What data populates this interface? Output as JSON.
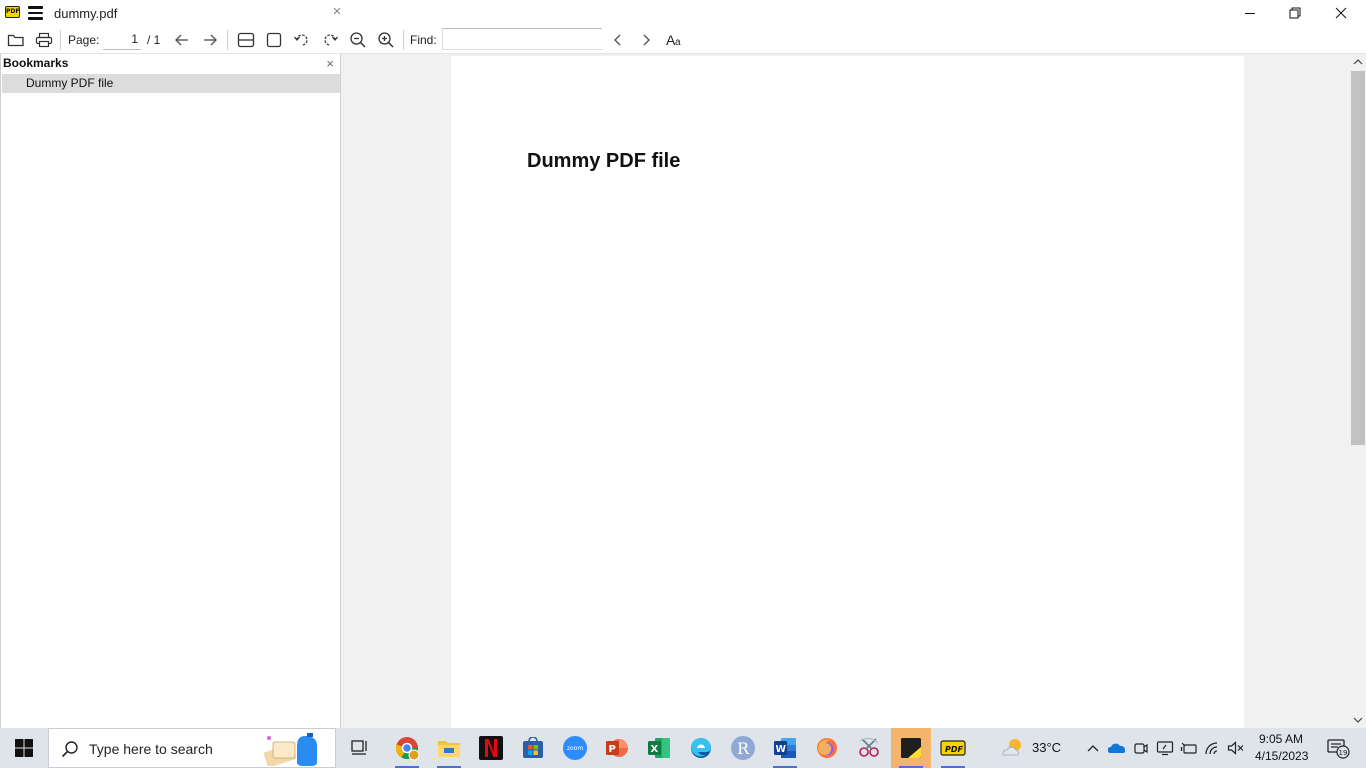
{
  "window": {
    "tab_title": "dummy.pdf",
    "tab_close": "×",
    "app_logo": "PDF"
  },
  "toolbar": {
    "page_label": "Page:",
    "page_value": "1",
    "page_total": "/ 1",
    "find_label": "Find:",
    "find_value": "",
    "icons": [
      "open-folder-icon",
      "print-icon",
      "prev-page-icon",
      "next-page-icon",
      "fit-width-icon",
      "fit-page-icon",
      "rotate-left-icon",
      "rotate-right-icon",
      "zoom-out-icon",
      "zoom-in-icon",
      "find-prev-icon",
      "find-next-icon",
      "match-case-icon"
    ]
  },
  "sidebar": {
    "title": "Bookmarks",
    "close": "×",
    "items": [
      {
        "label": "Dummy PDF file",
        "selected": true
      }
    ]
  },
  "document": {
    "heading": "Dummy PDF file"
  },
  "taskbar": {
    "search_placeholder": "Type here to search",
    "apps": [
      "chrome",
      "file-explorer",
      "netflix",
      "microsoft-store",
      "zoom",
      "powerpoint",
      "excel",
      "edge",
      "r",
      "word",
      "firefox",
      "snipping-tool",
      "sticky-notes",
      "sumatra-pdf"
    ],
    "zoom_label": "zoom",
    "r_label": "R",
    "weather_temp": "33°C",
    "time": "9:05 AM",
    "date": "4/15/2023",
    "notification_count": "19"
  },
  "colors": {
    "accent": "#4c6fd6",
    "doc_background": "#f1f1f1",
    "selected_bookmark": "#dcdcdc"
  }
}
